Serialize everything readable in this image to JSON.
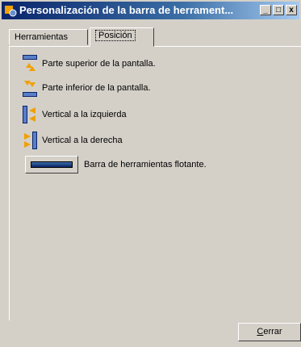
{
  "window": {
    "title": "Personalización de la barra de herrament...",
    "controls": [
      "_",
      "□",
      "x"
    ]
  },
  "tabs": [
    {
      "label": "Herramientas",
      "active": false
    },
    {
      "label": "Posición",
      "active": true
    }
  ],
  "options": [
    {
      "label": "Parte superior de la pantalla.",
      "icon": "dock-top-icon"
    },
    {
      "label": "Parte inferior de la pantalla.",
      "icon": "dock-bottom-icon"
    },
    {
      "label": "Vertical a la izquierda",
      "icon": "dock-left-icon"
    },
    {
      "label": "Vertical a la derecha",
      "icon": "dock-right-icon"
    }
  ],
  "floating": {
    "label": "Barra de herramientas flotante.",
    "icon": "floating-toolbar-icon"
  },
  "footer": {
    "close_label_first": "C",
    "close_label_rest": "errar"
  },
  "colors": {
    "accent_blue": "#0a246a",
    "arrow_orange": "#f0a000",
    "face": "#d4d0c8"
  }
}
